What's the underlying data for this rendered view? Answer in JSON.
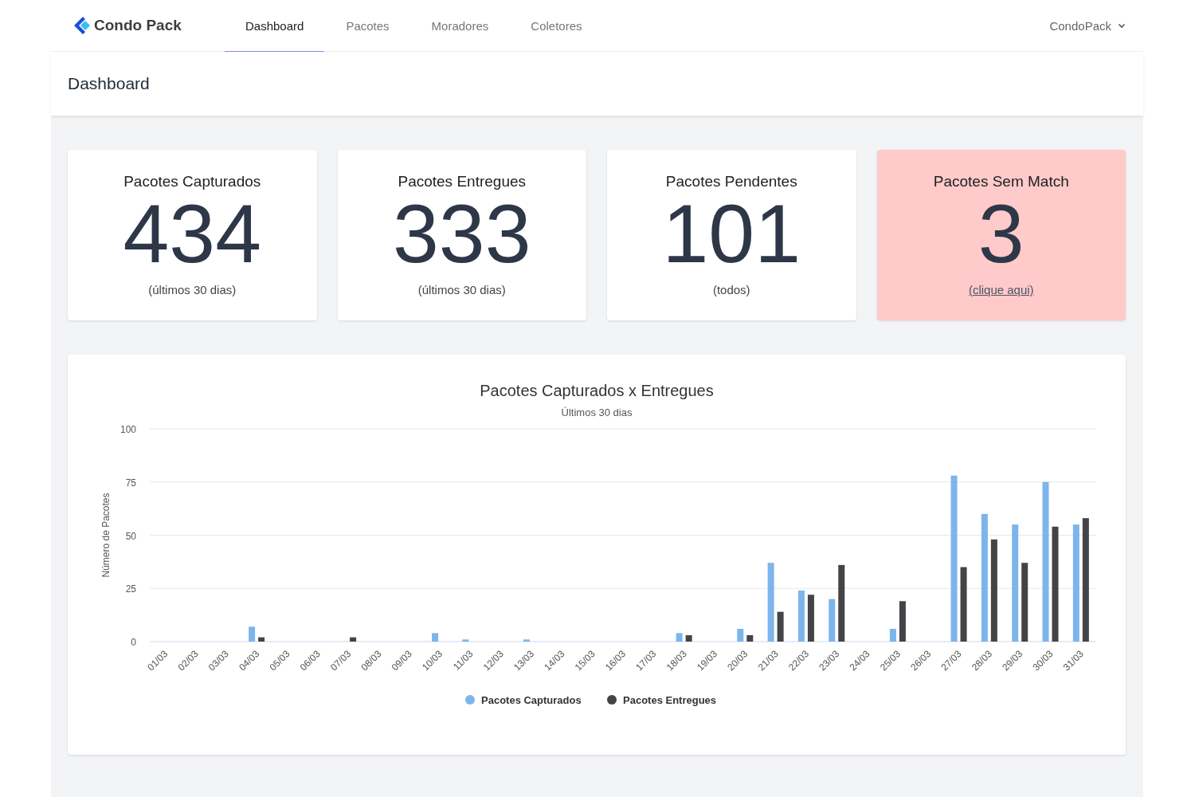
{
  "nav": {
    "logo": "Condo Pack",
    "tabs": [
      {
        "label": "Dashboard",
        "selected": true
      },
      {
        "label": "Pacotes",
        "selected": false
      },
      {
        "label": "Moradores",
        "selected": false
      },
      {
        "label": "Coletores",
        "selected": false
      }
    ],
    "user_menu": "CondoPack"
  },
  "page_title": "Dashboard",
  "stat_cards": [
    {
      "title": "Pacotes Capturados",
      "value": "434",
      "note": "(últimos 30 dias)",
      "kind": "plain"
    },
    {
      "title": "Pacotes Entregues",
      "value": "333",
      "note": "(últimos 30 dias)",
      "kind": "plain"
    },
    {
      "title": "Pacotes Pendentes",
      "value": "101",
      "note": "(todos)",
      "kind": "plain"
    },
    {
      "title": "Pacotes Sem Match",
      "value": "3",
      "note": "(clique aqui)",
      "kind": "alert"
    }
  ],
  "chart": {
    "subtitle": "Últimos 30 dias",
    "chart_data": {
      "type": "bar",
      "title": "Pacotes Capturados x Entregues",
      "ylabel": "Número de Pacotes",
      "categories": [
        "01/03",
        "02/03",
        "03/03",
        "04/03",
        "05/03",
        "06/03",
        "07/03",
        "08/03",
        "09/03",
        "10/03",
        "11/03",
        "12/03",
        "13/03",
        "14/03",
        "15/03",
        "16/03",
        "17/03",
        "18/03",
        "19/03",
        "20/03",
        "21/03",
        "22/03",
        "23/03",
        "24/03",
        "25/03",
        "26/03",
        "27/03",
        "28/03",
        "29/03",
        "30/03",
        "31/03"
      ],
      "grid": true,
      "legend": true,
      "ylim": [
        0,
        100
      ],
      "yticks": [
        0,
        25,
        50,
        75,
        100
      ],
      "series": [
        {
          "name": "Pacotes Capturados",
          "color": "#7cb5ec",
          "values": [
            0,
            0,
            0,
            7,
            0,
            0,
            0,
            0,
            0,
            4,
            1,
            0,
            1,
            0,
            0,
            0,
            0,
            4,
            0,
            6,
            37,
            24,
            20,
            0,
            6,
            0,
            78,
            60,
            55,
            75,
            55
          ]
        },
        {
          "name": "Pacotes Entregues",
          "color": "#434348",
          "values": [
            0,
            0,
            0,
            2,
            0,
            0,
            2,
            0,
            0,
            0,
            0,
            0,
            0,
            0,
            0,
            0,
            0,
            3,
            0,
            3,
            14,
            22,
            36,
            0,
            19,
            0,
            35,
            48,
            37,
            54,
            58
          ]
        }
      ]
    }
  }
}
